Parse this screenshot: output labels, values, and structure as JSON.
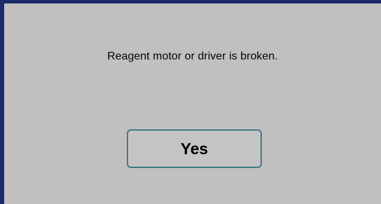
{
  "dialog": {
    "message": "Reagent motor or driver is broken.",
    "yes_label": "Yes"
  },
  "colors": {
    "frame_border": "#1b2a6b",
    "dialog_background": "#c0c0c0",
    "button_border": "#3d7a86"
  }
}
